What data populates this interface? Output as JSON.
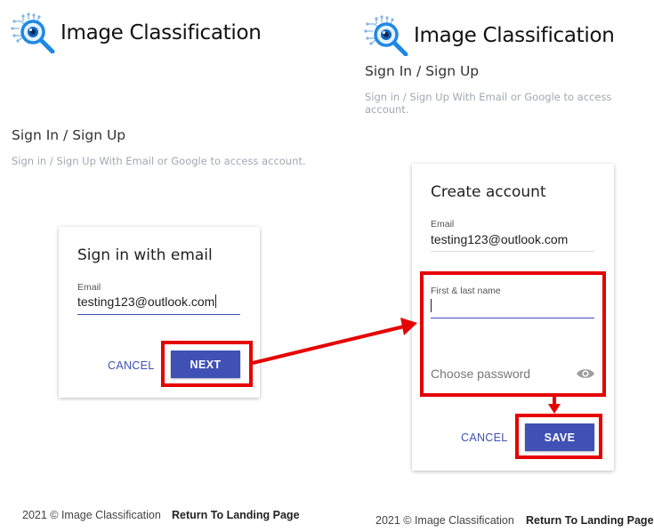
{
  "left": {
    "brand": {
      "title": "Image Classification",
      "icon": "magnifier-brain-logo-icon"
    },
    "heading": "Sign In / Sign Up",
    "subheading": "Sign in / Sign Up With Email or Google to access account.",
    "card": {
      "title": "Sign in with email",
      "email_label": "Email",
      "email_value": "testing123@outlook.com",
      "cancel_label": "CANCEL",
      "next_label": "NEXT"
    },
    "footer": {
      "copyright": "2021 © Image Classification",
      "link": "Return To Landing Page"
    }
  },
  "right": {
    "brand": {
      "title": "Image Classification",
      "icon": "magnifier-brain-logo-icon"
    },
    "heading": "Sign In / Sign Up",
    "subheading": "Sign in / Sign Up With Email or Google to access account.",
    "card": {
      "title": "Create account",
      "email_label": "Email",
      "email_value": "testing123@outlook.com",
      "name_label": "First & last name",
      "name_value": "",
      "password_placeholder": "Choose password",
      "password_icon": "eye-icon",
      "cancel_label": "CANCEL",
      "save_label": "SAVE"
    },
    "footer": {
      "copyright": "2021 © Image Classification",
      "link": "Return To Landing Page"
    }
  },
  "colors": {
    "primary": "#3f51b5",
    "highlight": "#e60000",
    "logo_blue": "#1e88e5"
  }
}
